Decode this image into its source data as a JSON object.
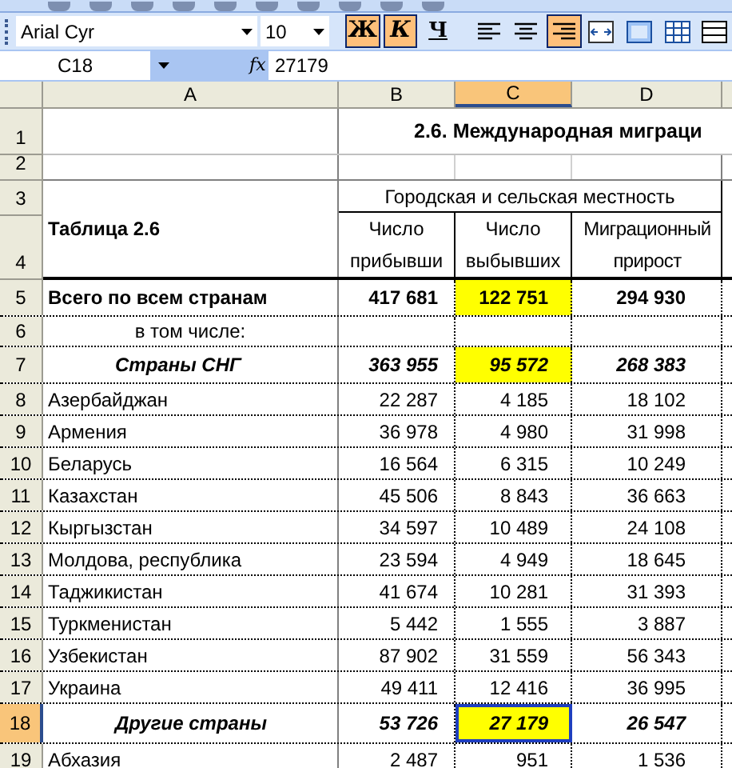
{
  "toolbar": {
    "font": "Arial Cyr",
    "size": "10",
    "buttons": [
      {
        "kind": "bold",
        "label": "Ж",
        "selected": true
      },
      {
        "kind": "italic",
        "label": "К",
        "selected": true
      },
      {
        "kind": "underline",
        "label": "Ч",
        "selected": false
      },
      {
        "kind": "align_left",
        "selected": false
      },
      {
        "kind": "align_center",
        "selected": false
      },
      {
        "kind": "align_right",
        "selected": true
      },
      {
        "kind": "merge",
        "selected": false
      },
      {
        "kind": "frame",
        "selected": false
      },
      {
        "kind": "grid",
        "selected": false
      },
      {
        "kind": "table",
        "selected": false
      }
    ]
  },
  "formula_bar": {
    "cell": "C18",
    "fx": "fx",
    "value": "27179"
  },
  "columns": [
    {
      "label": "A",
      "selected": false
    },
    {
      "label": "B",
      "selected": false
    },
    {
      "label": "C",
      "selected": true
    },
    {
      "label": "D",
      "selected": false
    }
  ],
  "header": {
    "row_numbers": [
      "1",
      "2",
      "3",
      "4"
    ],
    "title": "2.6. Международная миграци",
    "caption": "Таблица 2.6",
    "group": "Городская и сельская местность",
    "headings": [
      "Число прибывши",
      "Число выбывших",
      "Миграционный прирост"
    ]
  },
  "rows": [
    {
      "number": "5",
      "selected": false,
      "kind": "total",
      "cells": [
        "Всего по всем странам",
        "417 681",
        "122 751",
        "294 930"
      ],
      "highlighted": [
        false,
        false,
        true,
        false
      ],
      "active": [
        false,
        false,
        false,
        false
      ]
    },
    {
      "number": "6",
      "selected": false,
      "kind": "note",
      "cells": [
        "в том числе:",
        "",
        "",
        ""
      ],
      "highlighted": [
        false,
        false,
        false,
        false
      ],
      "active": [
        false,
        false,
        false,
        false
      ]
    },
    {
      "number": "7",
      "selected": false,
      "kind": "group",
      "cells": [
        "Страны СНГ",
        "363 955",
        "95 572",
        "268 383"
      ],
      "highlighted": [
        false,
        false,
        true,
        false
      ],
      "active": [
        false,
        false,
        false,
        false
      ]
    },
    {
      "number": "8",
      "selected": false,
      "kind": "country",
      "cells": [
        "Азербайджан",
        "22 287",
        "4 185",
        "18 102"
      ],
      "highlighted": [
        false,
        false,
        false,
        false
      ],
      "active": [
        false,
        false,
        false,
        false
      ]
    },
    {
      "number": "9",
      "selected": false,
      "kind": "country",
      "cells": [
        "Армения",
        "36 978",
        "4 980",
        "31 998"
      ],
      "highlighted": [
        false,
        false,
        false,
        false
      ],
      "active": [
        false,
        false,
        false,
        false
      ]
    },
    {
      "number": "10",
      "selected": false,
      "kind": "country",
      "cells": [
        "Беларусь",
        "16 564",
        "6 315",
        "10 249"
      ],
      "highlighted": [
        false,
        false,
        false,
        false
      ],
      "active": [
        false,
        false,
        false,
        false
      ]
    },
    {
      "number": "11",
      "selected": false,
      "kind": "country",
      "cells": [
        "Казахстан",
        "45 506",
        "8 843",
        "36 663"
      ],
      "highlighted": [
        false,
        false,
        false,
        false
      ],
      "active": [
        false,
        false,
        false,
        false
      ]
    },
    {
      "number": "12",
      "selected": false,
      "kind": "country",
      "cells": [
        "Кыргызстан",
        "34 597",
        "10 489",
        "24 108"
      ],
      "highlighted": [
        false,
        false,
        false,
        false
      ],
      "active": [
        false,
        false,
        false,
        false
      ]
    },
    {
      "number": "13",
      "selected": false,
      "kind": "country",
      "cells": [
        "Молдова, республика",
        "23 594",
        "4 949",
        "18 645"
      ],
      "highlighted": [
        false,
        false,
        false,
        false
      ],
      "active": [
        false,
        false,
        false,
        false
      ]
    },
    {
      "number": "14",
      "selected": false,
      "kind": "country",
      "cells": [
        "Таджикистан",
        "41 674",
        "10 281",
        "31 393"
      ],
      "highlighted": [
        false,
        false,
        false,
        false
      ],
      "active": [
        false,
        false,
        false,
        false
      ]
    },
    {
      "number": "15",
      "selected": false,
      "kind": "country",
      "cells": [
        "Туркменистан",
        "5 442",
        "1 555",
        "3 887"
      ],
      "highlighted": [
        false,
        false,
        false,
        false
      ],
      "active": [
        false,
        false,
        false,
        false
      ]
    },
    {
      "number": "16",
      "selected": false,
      "kind": "country",
      "cells": [
        "Узбекистан",
        "87 902",
        "31 559",
        "56 343"
      ],
      "highlighted": [
        false,
        false,
        false,
        false
      ],
      "active": [
        false,
        false,
        false,
        false
      ]
    },
    {
      "number": "17",
      "selected": false,
      "kind": "country",
      "cells": [
        "Украина",
        "49 411",
        "12 416",
        "36 995"
      ],
      "highlighted": [
        false,
        false,
        false,
        false
      ],
      "active": [
        false,
        false,
        false,
        false
      ]
    },
    {
      "number": "18",
      "selected": true,
      "kind": "group",
      "cells": [
        "Другие страны",
        "53 726",
        "27 179",
        "26 547"
      ],
      "highlighted": [
        false,
        false,
        true,
        false
      ],
      "active": [
        false,
        false,
        true,
        false
      ]
    },
    {
      "number": "19",
      "selected": false,
      "kind": "country",
      "cells": [
        "Абхазия",
        "2 487",
        "951",
        "1 536"
      ],
      "highlighted": [
        false,
        false,
        false,
        false
      ],
      "active": [
        false,
        false,
        false,
        false
      ]
    }
  ]
}
